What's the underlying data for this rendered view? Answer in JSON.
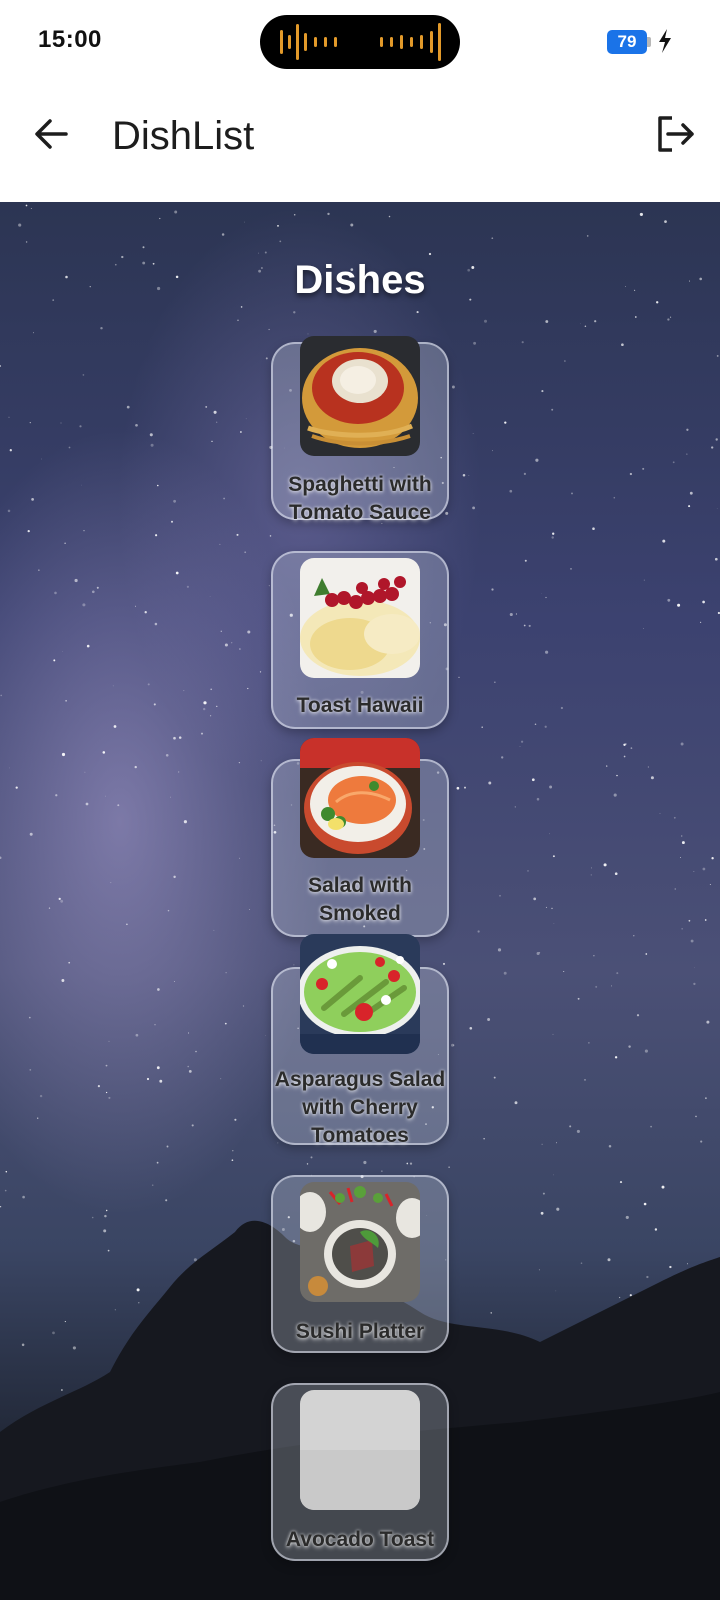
{
  "status_bar": {
    "time": "15:00",
    "battery_level": "79",
    "charging": true
  },
  "app_bar": {
    "title": "DishList",
    "back_icon": "arrow-left-icon",
    "logout_icon": "logout-icon"
  },
  "main": {
    "section_title": "Dishes",
    "dishes": [
      {
        "name": "Spaghetti with Tomato Sauce",
        "image": "spaghetti-photo"
      },
      {
        "name": "Toast Hawaii",
        "image": "toast-hawaii-photo"
      },
      {
        "name": "Salad with Smoked",
        "image": "salmon-salad-photo"
      },
      {
        "name": "Asparagus Salad with Cherry Tomatoes",
        "image": "asparagus-salad-photo"
      },
      {
        "name": "Sushi Platter",
        "image": "sushi-platter-photo"
      },
      {
        "name": "Avocado Toast",
        "image": "placeholder-image"
      }
    ]
  },
  "colors": {
    "accent_battery": "#1a73e8",
    "island_wave": "#e39a2a",
    "background_dark": "#111318"
  }
}
